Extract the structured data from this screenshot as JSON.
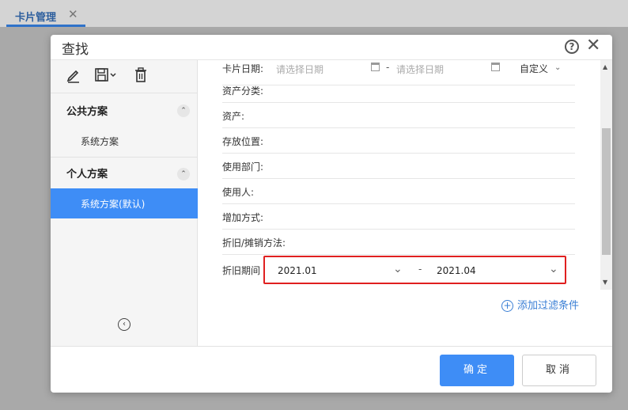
{
  "tab": {
    "label": "卡片管理",
    "close": "✕"
  },
  "dialog": {
    "title": "查找",
    "help": "?",
    "close": "✕",
    "ok_label": "确定",
    "cancel_label": "取消"
  },
  "sidebar": {
    "public_group": "公共方案",
    "public_items": [
      "系统方案"
    ],
    "personal_group": "个人方案",
    "personal_items": [
      "系统方案(默认)"
    ],
    "toggle": "⌃",
    "collapse": "‹"
  },
  "form": {
    "card_date": {
      "label": "卡片日期:",
      "start_placeholder": "请选择日期",
      "end_placeholder": "请选择日期",
      "separator": "-",
      "mode": "自定义"
    },
    "fields": [
      {
        "label": "资产分类:"
      },
      {
        "label": "资产:"
      },
      {
        "label": "存放位置:"
      },
      {
        "label": "使用部门:"
      },
      {
        "label": "使用人:"
      },
      {
        "label": "增加方式:"
      },
      {
        "label": "折旧/摊销方法:"
      }
    ],
    "period": {
      "label": "折旧期间",
      "start": "2021.01",
      "end": "2021.04",
      "separator": "-"
    },
    "add_filter": "添加过滤条件"
  },
  "colors": {
    "accent": "#3e8df6",
    "highlight": "#e02020"
  }
}
